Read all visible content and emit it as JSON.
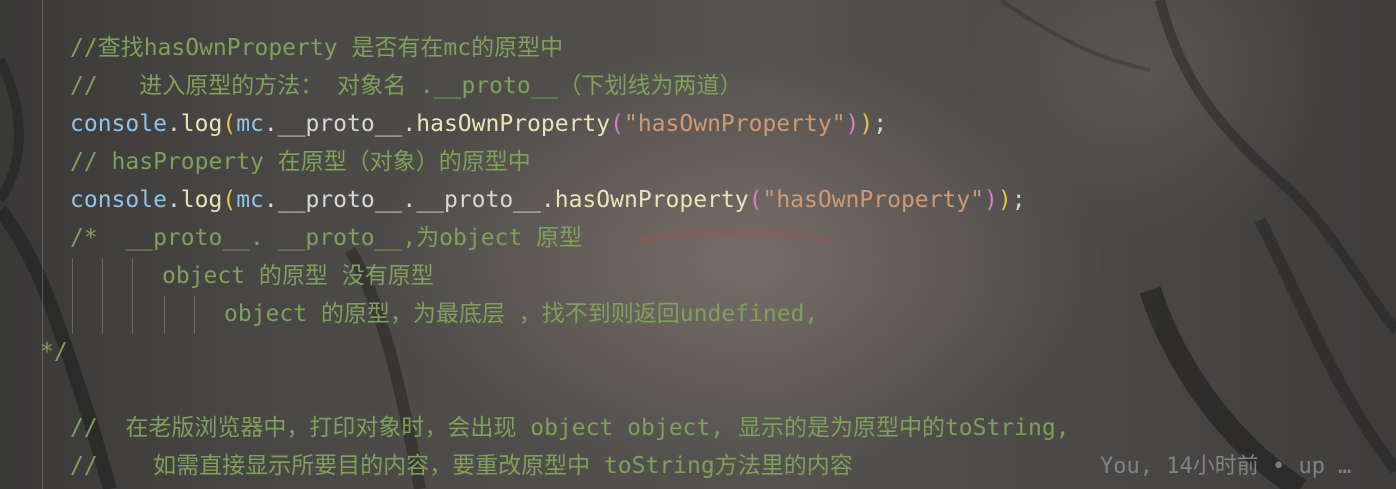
{
  "code_lines": [
    {
      "parts": [
        {
          "t": "//查找hasOwnProperty 是否有在mc的原型中",
          "c": "comment"
        }
      ]
    },
    {
      "parts": [
        {
          "t": "//   进入原型的方法： 对象名 .__proto__（下划线为两道）",
          "c": "comment"
        }
      ]
    },
    {
      "parts": [
        {
          "t": "console",
          "c": "ident"
        },
        {
          "t": ".",
          "c": "punct"
        },
        {
          "t": "log",
          "c": "call"
        },
        {
          "t": "(",
          "c": "paren1"
        },
        {
          "t": "mc",
          "c": "ident"
        },
        {
          "t": ".",
          "c": "punct"
        },
        {
          "t": "__proto__",
          "c": "prop"
        },
        {
          "t": ".",
          "c": "punct"
        },
        {
          "t": "hasOwnProperty",
          "c": "call"
        },
        {
          "t": "(",
          "c": "paren2"
        },
        {
          "t": "\"hasOwnProperty\"",
          "c": "string"
        },
        {
          "t": ")",
          "c": "paren2"
        },
        {
          "t": ")",
          "c": "paren1"
        },
        {
          "t": ";",
          "c": "punct"
        }
      ]
    },
    {
      "parts": [
        {
          "t": "// hasProperty 在原型（对象）的原型中",
          "c": "comment"
        }
      ]
    },
    {
      "parts": [
        {
          "t": "console",
          "c": "ident"
        },
        {
          "t": ".",
          "c": "punct"
        },
        {
          "t": "log",
          "c": "call"
        },
        {
          "t": "(",
          "c": "paren1"
        },
        {
          "t": "mc",
          "c": "ident"
        },
        {
          "t": ".",
          "c": "punct"
        },
        {
          "t": "__proto__",
          "c": "prop"
        },
        {
          "t": ".",
          "c": "punct"
        },
        {
          "t": "__proto__",
          "c": "prop"
        },
        {
          "t": ".",
          "c": "punct"
        },
        {
          "t": "hasOwnProperty",
          "c": "call"
        },
        {
          "t": "(",
          "c": "paren2"
        },
        {
          "t": "\"hasOwnProperty\"",
          "c": "string"
        },
        {
          "t": ")",
          "c": "paren2"
        },
        {
          "t": ")",
          "c": "paren1"
        },
        {
          "t": ";",
          "c": "punct"
        }
      ]
    },
    {
      "parts": [
        {
          "t": "/*  __proto__. __proto__,为object 原型",
          "c": "comment"
        }
      ]
    },
    {
      "parts": [
        {
          "t": "object 的原型 没有原型",
          "c": "comment"
        }
      ]
    },
    {
      "parts": [
        {
          "t": "object 的原型，为最底层 ，找不到则返回undefined,",
          "c": "comment"
        }
      ]
    },
    {
      "parts": [
        {
          "t": "*/",
          "c": "comment"
        }
      ]
    },
    {
      "parts": [
        {
          "t": "",
          "c": "comment"
        }
      ]
    },
    {
      "parts": [
        {
          "t": "//  在老版浏览器中，打印对象时，会出现 object object, 显示的是为原型中的toString,",
          "c": "comment"
        }
      ]
    },
    {
      "parts": [
        {
          "t": "//    如需直接显示所要目的内容，要重改原型中 toString方法里的内容",
          "c": "comment"
        }
      ]
    }
  ],
  "blame": "You, 14小时前 • up …"
}
